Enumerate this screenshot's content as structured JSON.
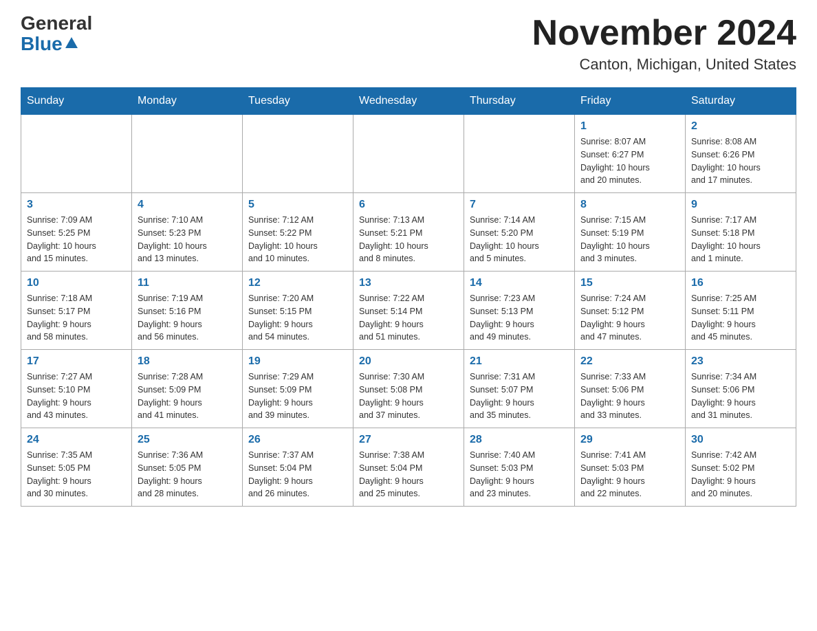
{
  "header": {
    "logo_general": "General",
    "logo_blue": "Blue",
    "month_title": "November 2024",
    "location": "Canton, Michigan, United States"
  },
  "days_of_week": [
    "Sunday",
    "Monday",
    "Tuesday",
    "Wednesday",
    "Thursday",
    "Friday",
    "Saturday"
  ],
  "weeks": [
    [
      {
        "day": "",
        "info": ""
      },
      {
        "day": "",
        "info": ""
      },
      {
        "day": "",
        "info": ""
      },
      {
        "day": "",
        "info": ""
      },
      {
        "day": "",
        "info": ""
      },
      {
        "day": "1",
        "info": "Sunrise: 8:07 AM\nSunset: 6:27 PM\nDaylight: 10 hours\nand 20 minutes."
      },
      {
        "day": "2",
        "info": "Sunrise: 8:08 AM\nSunset: 6:26 PM\nDaylight: 10 hours\nand 17 minutes."
      }
    ],
    [
      {
        "day": "3",
        "info": "Sunrise: 7:09 AM\nSunset: 5:25 PM\nDaylight: 10 hours\nand 15 minutes."
      },
      {
        "day": "4",
        "info": "Sunrise: 7:10 AM\nSunset: 5:23 PM\nDaylight: 10 hours\nand 13 minutes."
      },
      {
        "day": "5",
        "info": "Sunrise: 7:12 AM\nSunset: 5:22 PM\nDaylight: 10 hours\nand 10 minutes."
      },
      {
        "day": "6",
        "info": "Sunrise: 7:13 AM\nSunset: 5:21 PM\nDaylight: 10 hours\nand 8 minutes."
      },
      {
        "day": "7",
        "info": "Sunrise: 7:14 AM\nSunset: 5:20 PM\nDaylight: 10 hours\nand 5 minutes."
      },
      {
        "day": "8",
        "info": "Sunrise: 7:15 AM\nSunset: 5:19 PM\nDaylight: 10 hours\nand 3 minutes."
      },
      {
        "day": "9",
        "info": "Sunrise: 7:17 AM\nSunset: 5:18 PM\nDaylight: 10 hours\nand 1 minute."
      }
    ],
    [
      {
        "day": "10",
        "info": "Sunrise: 7:18 AM\nSunset: 5:17 PM\nDaylight: 9 hours\nand 58 minutes."
      },
      {
        "day": "11",
        "info": "Sunrise: 7:19 AM\nSunset: 5:16 PM\nDaylight: 9 hours\nand 56 minutes."
      },
      {
        "day": "12",
        "info": "Sunrise: 7:20 AM\nSunset: 5:15 PM\nDaylight: 9 hours\nand 54 minutes."
      },
      {
        "day": "13",
        "info": "Sunrise: 7:22 AM\nSunset: 5:14 PM\nDaylight: 9 hours\nand 51 minutes."
      },
      {
        "day": "14",
        "info": "Sunrise: 7:23 AM\nSunset: 5:13 PM\nDaylight: 9 hours\nand 49 minutes."
      },
      {
        "day": "15",
        "info": "Sunrise: 7:24 AM\nSunset: 5:12 PM\nDaylight: 9 hours\nand 47 minutes."
      },
      {
        "day": "16",
        "info": "Sunrise: 7:25 AM\nSunset: 5:11 PM\nDaylight: 9 hours\nand 45 minutes."
      }
    ],
    [
      {
        "day": "17",
        "info": "Sunrise: 7:27 AM\nSunset: 5:10 PM\nDaylight: 9 hours\nand 43 minutes."
      },
      {
        "day": "18",
        "info": "Sunrise: 7:28 AM\nSunset: 5:09 PM\nDaylight: 9 hours\nand 41 minutes."
      },
      {
        "day": "19",
        "info": "Sunrise: 7:29 AM\nSunset: 5:09 PM\nDaylight: 9 hours\nand 39 minutes."
      },
      {
        "day": "20",
        "info": "Sunrise: 7:30 AM\nSunset: 5:08 PM\nDaylight: 9 hours\nand 37 minutes."
      },
      {
        "day": "21",
        "info": "Sunrise: 7:31 AM\nSunset: 5:07 PM\nDaylight: 9 hours\nand 35 minutes."
      },
      {
        "day": "22",
        "info": "Sunrise: 7:33 AM\nSunset: 5:06 PM\nDaylight: 9 hours\nand 33 minutes."
      },
      {
        "day": "23",
        "info": "Sunrise: 7:34 AM\nSunset: 5:06 PM\nDaylight: 9 hours\nand 31 minutes."
      }
    ],
    [
      {
        "day": "24",
        "info": "Sunrise: 7:35 AM\nSunset: 5:05 PM\nDaylight: 9 hours\nand 30 minutes."
      },
      {
        "day": "25",
        "info": "Sunrise: 7:36 AM\nSunset: 5:05 PM\nDaylight: 9 hours\nand 28 minutes."
      },
      {
        "day": "26",
        "info": "Sunrise: 7:37 AM\nSunset: 5:04 PM\nDaylight: 9 hours\nand 26 minutes."
      },
      {
        "day": "27",
        "info": "Sunrise: 7:38 AM\nSunset: 5:04 PM\nDaylight: 9 hours\nand 25 minutes."
      },
      {
        "day": "28",
        "info": "Sunrise: 7:40 AM\nSunset: 5:03 PM\nDaylight: 9 hours\nand 23 minutes."
      },
      {
        "day": "29",
        "info": "Sunrise: 7:41 AM\nSunset: 5:03 PM\nDaylight: 9 hours\nand 22 minutes."
      },
      {
        "day": "30",
        "info": "Sunrise: 7:42 AM\nSunset: 5:02 PM\nDaylight: 9 hours\nand 20 minutes."
      }
    ]
  ]
}
